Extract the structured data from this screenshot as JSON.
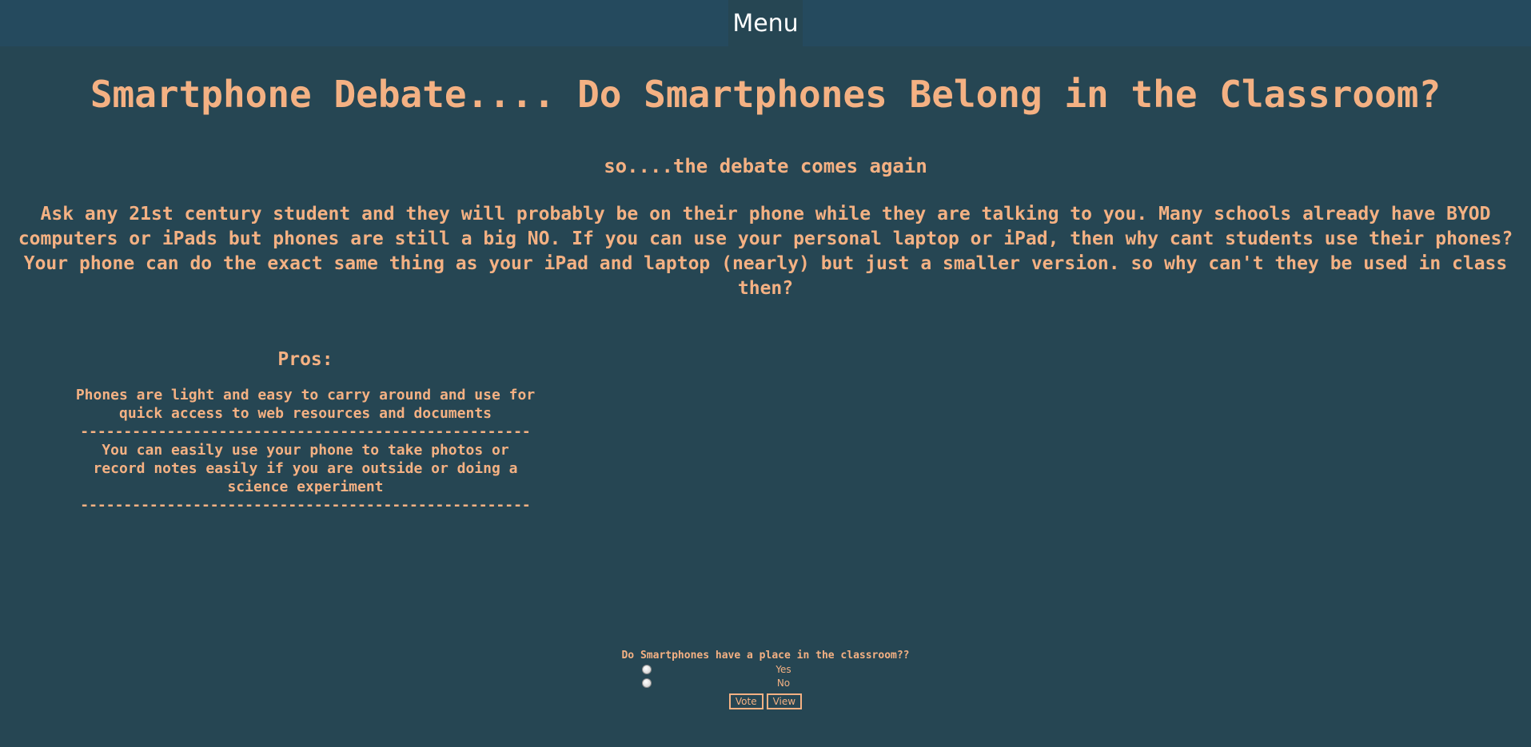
{
  "nav": {
    "menu_label": "Menu"
  },
  "page": {
    "title": "Smartphone Debate.... Do Smartphones Belong in the Classroom?",
    "subtitle": "so....the debate comes again",
    "intro": "Ask any 21st century student and they will probably be on their phone while they are talking to you. Many schools already have BYOD computers or iPads but phones are still a big NO. If you can use your personal laptop or iPad, then why cant students use their phones? Your phone can do the exact same thing as your iPad and laptop (nearly) but just a smaller version. so why can't they be used in class then?"
  },
  "pros": {
    "heading": "Pros:",
    "items": [
      "Phones are light and easy to carry around and use for quick access to web resources and documents",
      "You can easily use your phone to take photos or record notes easily if you are outside or doing a science experiment"
    ],
    "separator": "----------------------------------------------------"
  },
  "poll": {
    "question": "Do Smartphones have a place in the classroom??",
    "options": [
      "Yes",
      "No"
    ],
    "vote_label": "Vote",
    "view_label": "View"
  },
  "colors": {
    "background": "#264653",
    "accent_text": "#f4b183",
    "menu_text": "#ffffff"
  }
}
